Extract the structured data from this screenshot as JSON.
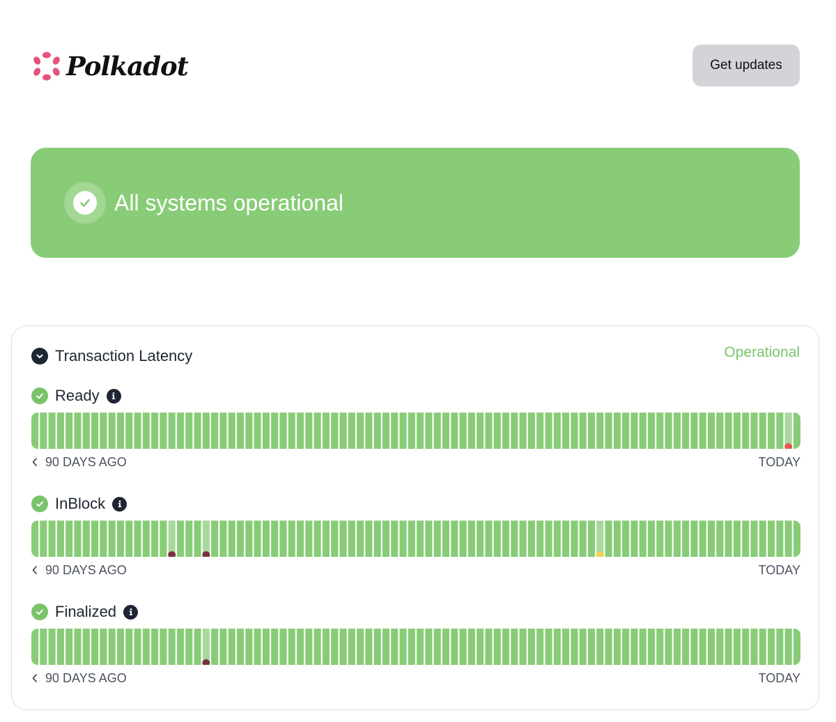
{
  "brand": {
    "name": "Polkadot",
    "logo_icon": "polkadot-logo-icon",
    "color": "#e6537a"
  },
  "header": {
    "get_updates_label": "Get updates"
  },
  "banner": {
    "title": "All systems operational",
    "icon": "check-icon",
    "color": "#88cc77"
  },
  "group": {
    "title": "Transaction Latency",
    "status": "Operational",
    "status_color": "#79c46a",
    "expand_icon": "chevron-down-icon"
  },
  "colors": {
    "up": "#88cc77",
    "up_hover": "#a8d99c",
    "red": "#e8574a",
    "maroon": "#7b2f45",
    "yellow": "#f3d24f"
  },
  "components": [
    {
      "name": "Ready",
      "range_start": "90 DAYS AGO",
      "range_end": "TODAY",
      "day_count": 90,
      "incidents": [
        {
          "day": 88,
          "severity": "red"
        }
      ]
    },
    {
      "name": "InBlock",
      "range_start": "90 DAYS AGO",
      "range_end": "TODAY",
      "day_count": 90,
      "incidents": [
        {
          "day": 16,
          "severity": "maroon"
        },
        {
          "day": 20,
          "severity": "maroon"
        },
        {
          "day": 66,
          "severity": "yellow"
        }
      ]
    },
    {
      "name": "Finalized",
      "range_start": "90 DAYS AGO",
      "range_end": "TODAY",
      "day_count": 90,
      "incidents": [
        {
          "day": 20,
          "severity": "maroon"
        }
      ]
    }
  ]
}
